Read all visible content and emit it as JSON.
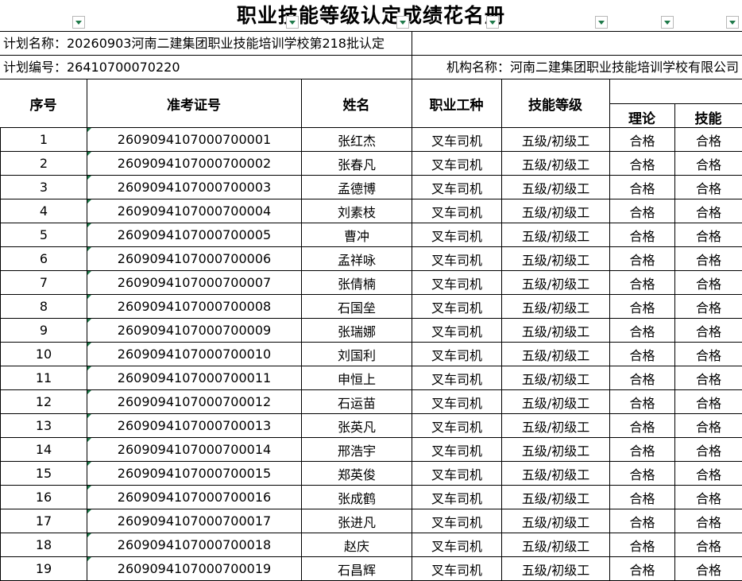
{
  "title": "职业技能等级认定成绩花名册",
  "plan_name": "计划名称：20260903河南二建集团职业技能培训学校第218批认定",
  "plan_code": "计划编号：26410700070220",
  "org_name": "机构名称：河南二建集团职业技能培训学校有限公司",
  "headers": {
    "seq": "序号",
    "exam_id": "准考证号",
    "name": "姓名",
    "job": "职业工种",
    "level": "技能等级",
    "theory": "理论",
    "skill": "技能"
  },
  "rows": [
    {
      "seq": "1",
      "exam_id": "2609094107000700001",
      "name": "张红杰",
      "job": "叉车司机",
      "level": "五级/初级工",
      "theory": "合格",
      "skill": "合格"
    },
    {
      "seq": "2",
      "exam_id": "2609094107000700002",
      "name": "张春凡",
      "job": "叉车司机",
      "level": "五级/初级工",
      "theory": "合格",
      "skill": "合格"
    },
    {
      "seq": "3",
      "exam_id": "2609094107000700003",
      "name": "孟德博",
      "job": "叉车司机",
      "level": "五级/初级工",
      "theory": "合格",
      "skill": "合格"
    },
    {
      "seq": "4",
      "exam_id": "2609094107000700004",
      "name": "刘素枝",
      "job": "叉车司机",
      "level": "五级/初级工",
      "theory": "合格",
      "skill": "合格"
    },
    {
      "seq": "5",
      "exam_id": "2609094107000700005",
      "name": "曹冲",
      "job": "叉车司机",
      "level": "五级/初级工",
      "theory": "合格",
      "skill": "合格"
    },
    {
      "seq": "6",
      "exam_id": "2609094107000700006",
      "name": "孟祥咏",
      "job": "叉车司机",
      "level": "五级/初级工",
      "theory": "合格",
      "skill": "合格"
    },
    {
      "seq": "7",
      "exam_id": "2609094107000700007",
      "name": "张倩楠",
      "job": "叉车司机",
      "level": "五级/初级工",
      "theory": "合格",
      "skill": "合格"
    },
    {
      "seq": "8",
      "exam_id": "2609094107000700008",
      "name": "石国垒",
      "job": "叉车司机",
      "level": "五级/初级工",
      "theory": "合格",
      "skill": "合格"
    },
    {
      "seq": "9",
      "exam_id": "2609094107000700009",
      "name": "张瑞娜",
      "job": "叉车司机",
      "level": "五级/初级工",
      "theory": "合格",
      "skill": "合格"
    },
    {
      "seq": "10",
      "exam_id": "2609094107000700010",
      "name": "刘国利",
      "job": "叉车司机",
      "level": "五级/初级工",
      "theory": "合格",
      "skill": "合格"
    },
    {
      "seq": "11",
      "exam_id": "2609094107000700011",
      "name": "申恒上",
      "job": "叉车司机",
      "level": "五级/初级工",
      "theory": "合格",
      "skill": "合格"
    },
    {
      "seq": "12",
      "exam_id": "2609094107000700012",
      "name": "石运苗",
      "job": "叉车司机",
      "level": "五级/初级工",
      "theory": "合格",
      "skill": "合格"
    },
    {
      "seq": "13",
      "exam_id": "2609094107000700013",
      "name": "张英凡",
      "job": "叉车司机",
      "level": "五级/初级工",
      "theory": "合格",
      "skill": "合格"
    },
    {
      "seq": "14",
      "exam_id": "2609094107000700014",
      "name": "邢浩宇",
      "job": "叉车司机",
      "level": "五级/初级工",
      "theory": "合格",
      "skill": "合格"
    },
    {
      "seq": "15",
      "exam_id": "2609094107000700015",
      "name": "郑英俊",
      "job": "叉车司机",
      "level": "五级/初级工",
      "theory": "合格",
      "skill": "合格"
    },
    {
      "seq": "16",
      "exam_id": "2609094107000700016",
      "name": "张成鹤",
      "job": "叉车司机",
      "level": "五级/初级工",
      "theory": "合格",
      "skill": "合格"
    },
    {
      "seq": "17",
      "exam_id": "2609094107000700017",
      "name": "张进凡",
      "job": "叉车司机",
      "level": "五级/初级工",
      "theory": "合格",
      "skill": "合格"
    },
    {
      "seq": "18",
      "exam_id": "2609094107000700018",
      "name": "赵庆",
      "job": "叉车司机",
      "level": "五级/初级工",
      "theory": "合格",
      "skill": "合格"
    },
    {
      "seq": "19",
      "exam_id": "2609094107000700019",
      "name": "石昌辉",
      "job": "叉车司机",
      "level": "五级/初级工",
      "theory": "合格",
      "skill": "合格"
    }
  ]
}
